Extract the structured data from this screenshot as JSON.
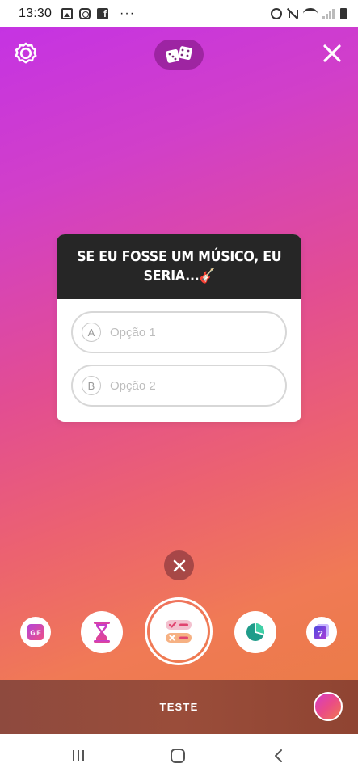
{
  "status_bar": {
    "time": "13:30",
    "left_icons": [
      "gallery-icon",
      "instagram-icon",
      "facebook-icon"
    ],
    "more": "···",
    "right_icons": [
      "alarm-icon",
      "mute-icon",
      "wifi-icon",
      "signal-icon",
      "battery-icon"
    ]
  },
  "top_controls": {
    "settings_icon": "gear-icon",
    "dice_icon": "dice-icon",
    "close_icon": "close-icon"
  },
  "poll": {
    "question_line1": "SE EU FOSSE UM MÚSICO, EU",
    "question_line2": "SERIA...",
    "question_emoji": "🎸",
    "options": [
      {
        "letter": "A",
        "placeholder": "Opção 1"
      },
      {
        "letter": "B",
        "placeholder": "Opção 2"
      }
    ]
  },
  "sticker_tray": {
    "items": [
      "gif-icon",
      "hourglass-icon",
      "poll-icon",
      "chart-icon",
      "question-icon"
    ],
    "gif_label": "GIF",
    "question_label": "?"
  },
  "caption": {
    "label": "TESTE"
  },
  "colors": {
    "gradient_top": "#c533e3",
    "gradient_bottom": "#eb7b48",
    "card_header": "#262626",
    "caption_bar": "#9a4d3a"
  }
}
